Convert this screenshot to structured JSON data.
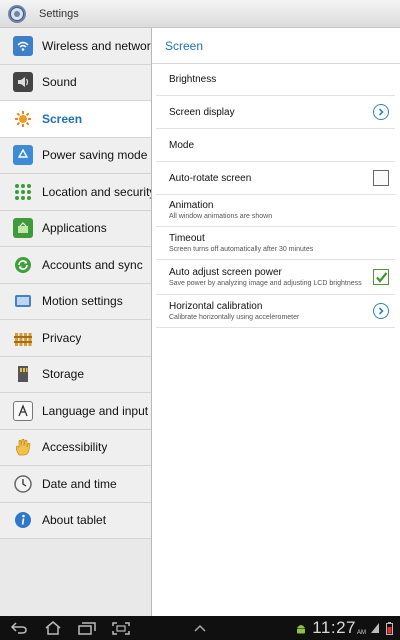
{
  "window": {
    "title": "Settings"
  },
  "sidebar": {
    "items": [
      {
        "label": "Wireless and networks",
        "icon": "wifi-icon"
      },
      {
        "label": "Sound",
        "icon": "speaker-icon"
      },
      {
        "label": "Screen",
        "icon": "brightness-icon",
        "selected": true
      },
      {
        "label": "Power saving mode",
        "icon": "recycle-icon"
      },
      {
        "label": "Location and security",
        "icon": "location-grid-icon"
      },
      {
        "label": "Applications",
        "icon": "applications-icon"
      },
      {
        "label": "Accounts and sync",
        "icon": "sync-icon"
      },
      {
        "label": "Motion settings",
        "icon": "motion-icon"
      },
      {
        "label": "Privacy",
        "icon": "privacy-fence-icon"
      },
      {
        "label": "Storage",
        "icon": "storage-card-icon"
      },
      {
        "label": "Language and input",
        "icon": "keyboard-letter-icon"
      },
      {
        "label": "Accessibility",
        "icon": "hand-icon"
      },
      {
        "label": "Date and time",
        "icon": "clock-icon"
      },
      {
        "label": "About tablet",
        "icon": "info-icon"
      }
    ]
  },
  "content": {
    "header": "Screen",
    "rows": [
      {
        "title": "Brightness",
        "subtitle": "",
        "control": "none"
      },
      {
        "title": "Screen display",
        "subtitle": "",
        "control": "chevron"
      },
      {
        "title": "Mode",
        "subtitle": "",
        "control": "none"
      },
      {
        "title": "Auto-rotate screen",
        "subtitle": "",
        "control": "checkbox",
        "checked": false
      },
      {
        "title": "Animation",
        "subtitle": "All window animations are shown",
        "control": "none"
      },
      {
        "title": "Timeout",
        "subtitle": "Screen turns off automatically after 30 minutes",
        "control": "none"
      },
      {
        "title": "Auto adjust screen power",
        "subtitle": "Save power by analyzing image and adjusting LCD brightness",
        "control": "checkbox",
        "checked": true
      },
      {
        "title": "Horizontal calibration",
        "subtitle": "Calibrate horizontally using accelerometer",
        "control": "chevron"
      }
    ]
  },
  "statusbar": {
    "time": "11:27",
    "ampm": "AM",
    "icons": [
      "android-notification-icon",
      "signal-icon",
      "battery-icon"
    ]
  },
  "navbar": {
    "buttons": [
      "back-icon",
      "home-icon",
      "recent-apps-icon",
      "screenshot-icon"
    ],
    "up_icon": "chevron-up-icon"
  },
  "colors": {
    "accent": "#1d6fb8",
    "check": "#3a9a2a"
  }
}
